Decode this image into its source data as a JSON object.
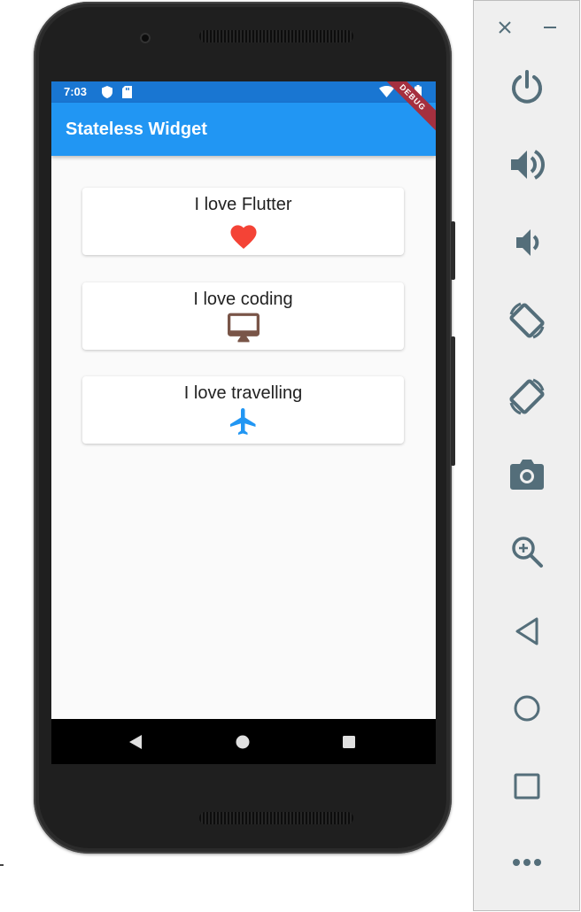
{
  "status_bar": {
    "time": "7:03"
  },
  "app_bar": {
    "title": "Stateless Widget"
  },
  "debug_banner": "DEBUG",
  "cards": [
    {
      "label": "I love Flutter",
      "icon": "heart-icon",
      "color": "#f44336"
    },
    {
      "label": "I love coding",
      "icon": "desktop-icon",
      "color": "#795548"
    },
    {
      "label": "I love travelling",
      "icon": "airplane-icon",
      "color": "#2196f3"
    }
  ],
  "nav_bar": {
    "icons": [
      "back-icon",
      "home-icon",
      "recents-icon"
    ]
  },
  "emulator_panel": {
    "buttons": [
      "close-icon",
      "minimize-icon",
      "power-icon",
      "volume-up-icon",
      "volume-down-icon",
      "rotate-left-icon",
      "rotate-right-icon",
      "screenshot-icon",
      "zoom-icon",
      "back-icon",
      "home-icon",
      "overview-icon",
      "more-icon"
    ]
  },
  "colors": {
    "status_bar": "#1976d2",
    "app_bar": "#2196f3",
    "screen_bg": "#fafafa",
    "panel_icon": "#546e7a"
  }
}
